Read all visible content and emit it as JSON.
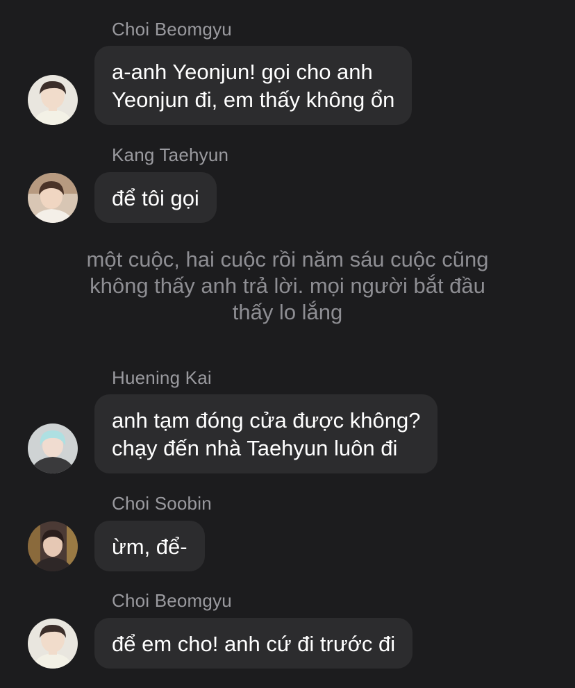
{
  "messages": [
    {
      "sender": "Choi Beomgyu",
      "avatar_icon": "avatar-photo-beomgyu",
      "lines": [
        "a-anh Yeonjun! gọi cho anh",
        "Yeonjun đi, em thấy không ổn"
      ]
    },
    {
      "sender": "Kang Taehyun",
      "avatar_icon": "avatar-photo-taehyun",
      "lines": [
        "để tôi gọi"
      ]
    },
    {
      "sender": "Huening Kai",
      "avatar_icon": "avatar-photo-hueningkai",
      "lines": [
        "anh tạm đóng cửa được không?",
        "chạy đến nhà Taehyun luôn đi"
      ]
    },
    {
      "sender": "Choi Soobin",
      "avatar_icon": "avatar-photo-soobin",
      "lines": [
        "ừm, để-"
      ]
    },
    {
      "sender": "Choi Beomgyu",
      "avatar_icon": "avatar-photo-beomgyu",
      "lines": [
        "để em cho! anh cứ đi trước đi"
      ]
    }
  ],
  "narration": {
    "lines": [
      "một cuộc, hai cuộc rồi năm sáu cuộc cũng",
      "không thấy anh trả lời. mọi người bắt đầu",
      "thấy lo lắng"
    ]
  },
  "colors": {
    "background": "#1c1c1e",
    "bubble": "#2c2c2e",
    "sender_name": "#9a9a9f",
    "narration": "#8e8e93",
    "message_text": "#ffffff"
  }
}
